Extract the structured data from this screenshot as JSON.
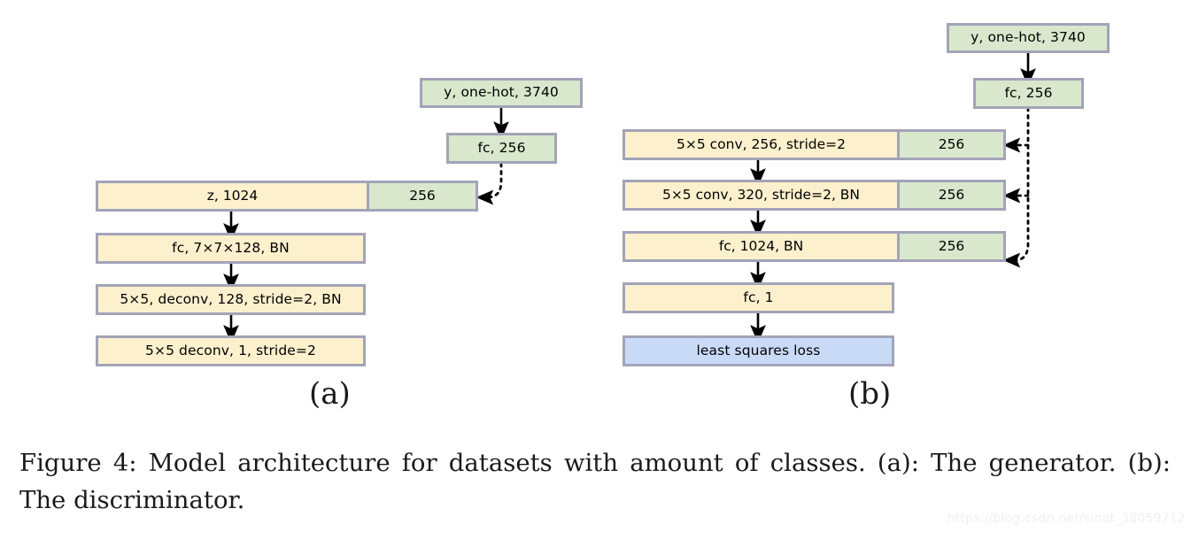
{
  "figure": {
    "caption": "Figure 4:  Model architecture for datasets with amount of classes.  (a): The generator. (b): The discriminator.",
    "watermark": "https://blog.csdn.net/sinat_38059712",
    "colors": {
      "yellow_fill": "#fdf0cd",
      "green_fill": "#d9e8cd",
      "blue_fill": "#c9daf7",
      "border": "#a3a3b8",
      "arrow": "#000000"
    }
  },
  "panel_a": {
    "label": "(a)",
    "nodes": {
      "label_input": "y, one-hot, 3740",
      "label_fc": "fc, 256",
      "z_main": "z, 1024",
      "z_side": "256",
      "fc_proj": "fc, 7×7×128, BN",
      "deconv1": "5×5, deconv, 128, stride=2, BN",
      "deconv2": "5×5 deconv, 1, stride=2"
    }
  },
  "panel_b": {
    "label": "(b)",
    "nodes": {
      "label_input": "y, one-hot, 3740",
      "label_fc": "fc, 256",
      "conv1_main": "5×5 conv, 256, stride=2",
      "conv1_side": "256",
      "conv2_main": "5×5 conv, 320, stride=2, BN",
      "conv2_side": "256",
      "fc1024_main": "fc, 1024, BN",
      "fc1024_side": "256",
      "fc1": "fc, 1",
      "loss": "least squares loss"
    }
  }
}
